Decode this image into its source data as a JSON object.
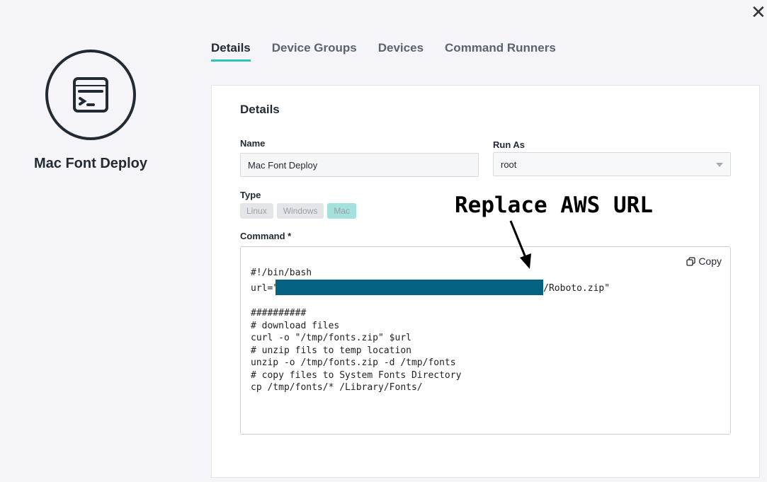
{
  "close_label": "✕",
  "sidebar": {
    "title": "Mac Font Deploy"
  },
  "tabs": [
    {
      "label": "Details"
    },
    {
      "label": "Device Groups"
    },
    {
      "label": "Devices"
    },
    {
      "label": "Command Runners"
    }
  ],
  "details": {
    "heading": "Details",
    "name_label": "Name",
    "name_value": "Mac Font Deploy",
    "run_as_label": "Run As",
    "run_as_value": "root",
    "type_label": "Type",
    "types": [
      "Linux",
      "Windows",
      "Mac"
    ],
    "selected_type": "Mac",
    "command_label": "Command *",
    "copy_label": "Copy",
    "command_lines": [
      "#!/bin/bash",
      "url=\"",
      "/Roboto.zip\"",
      "",
      "##########",
      "# download files",
      "curl -o \"/tmp/fonts.zip\" $url",
      "# unzip fils to temp location",
      "unzip -o /tmp/fonts.zip -d /tmp/fonts",
      "# copy files to System Fonts Directory",
      "cp /tmp/fonts/* /Library/Fonts/"
    ]
  },
  "annotation": "Replace AWS URL",
  "colors": {
    "accent": "#2ec4b6",
    "redaction": "#066282",
    "selected_type": "#a3e2dc"
  }
}
